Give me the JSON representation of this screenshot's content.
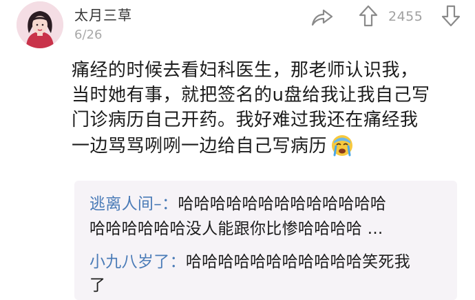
{
  "post": {
    "username": "太月三草",
    "date": "6/26",
    "vote_count": "2455",
    "content_lines": [
      "痛经的时候去看妇科医生，那老师认识我，",
      "当时她有事，就把签名的u盘给我让我自己写",
      "门诊病历自己开药。我好难过我还在痛经我",
      "一边骂骂咧咧一边给自己写病历"
    ],
    "icons": {
      "share": "share-icon",
      "upvote": "upvote-arrow-icon",
      "downvote": "downvote-arrow-icon",
      "emoji": "crying-emoji-icon"
    }
  },
  "replies": [
    {
      "name": "逃离人间–：",
      "line1": "哈哈哈哈哈哈哈哈哈哈哈哈哈",
      "line2": "哈哈哈哈哈哈没人能跟你比惨哈哈哈哈 ..."
    },
    {
      "name": "小九八岁了：",
      "line1": "哈哈哈哈哈哈哈哈哈哈哈笑死我",
      "line2": "了"
    }
  ],
  "colors": {
    "reply_name": "#4a7bb7",
    "reply_background": "#f6f3f7",
    "date": "#a8a8a8"
  }
}
